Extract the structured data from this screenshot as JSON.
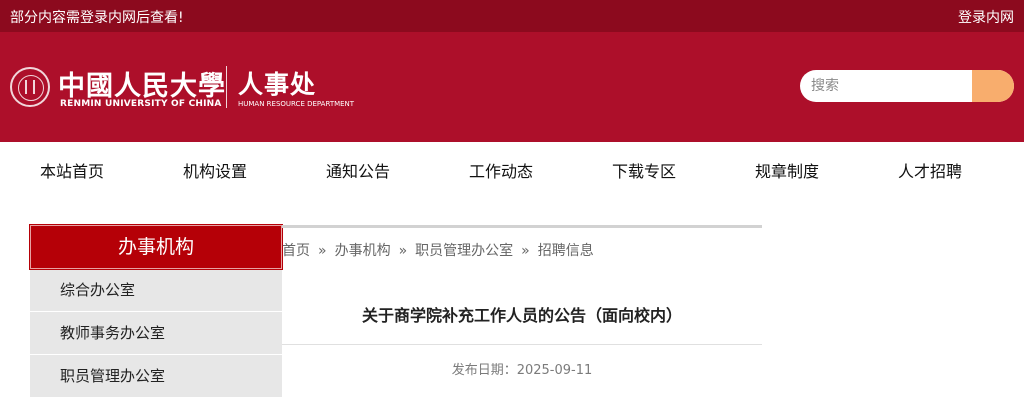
{
  "topbar": {
    "notice": "部分内容需登录内网后查看!",
    "login_link": "登录内网"
  },
  "header": {
    "university_cn": "中國人民大學",
    "university_en": "RENMIN UNIVERSITY OF CHINA",
    "department_cn": "人事处",
    "department_en": "HUMAN RESOURCE DEPARTMENT",
    "search_placeholder": "搜索"
  },
  "nav": {
    "items": [
      "本站首页",
      "机构设置",
      "通知公告",
      "工作动态",
      "下载专区",
      "规章制度",
      "人才招聘"
    ]
  },
  "sidebar": {
    "title": "办事机构",
    "items": [
      "综合办公室",
      "教师事务办公室",
      "职员管理办公室"
    ]
  },
  "breadcrumb": {
    "items": [
      "首页",
      "办事机构",
      "职员管理办公室",
      "招聘信息"
    ],
    "separator": "»"
  },
  "article": {
    "title": "关于商学院补充工作人员的公告（面向校内）",
    "date": "发布日期：2025-09-11"
  },
  "colors": {
    "topbar": "#8c0a1e",
    "banner": "#ad0f2a",
    "search_button": "#f8ad6d",
    "sidebar_title": "#b50007",
    "sidebar_item_bg": "#e7e7e7"
  },
  "icons": {
    "logo": "university-seal-icon",
    "search_button": "search-icon"
  }
}
